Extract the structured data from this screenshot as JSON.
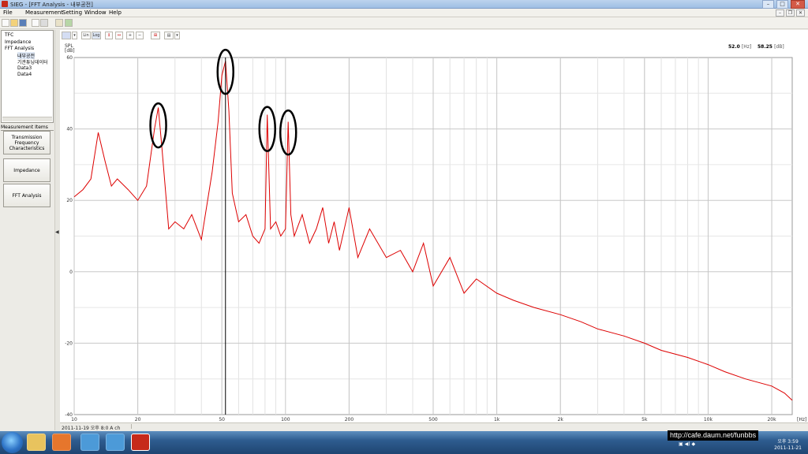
{
  "window": {
    "title": "SIEG - [FFT Analysis - 내부공전]"
  },
  "menu": [
    {
      "label": "File"
    },
    {
      "label": "Measurement"
    },
    {
      "label": "Setting"
    },
    {
      "label": "Window"
    },
    {
      "label": "Help"
    }
  ],
  "tree": [
    {
      "label": "TFC"
    },
    {
      "label": "Impedance"
    },
    {
      "label": "FFT Analysis"
    },
    {
      "label": "내부공전"
    },
    {
      "label": "기관튜닝데이터"
    },
    {
      "label": "Data3"
    },
    {
      "label": "Data4"
    }
  ],
  "measurement_items": {
    "header": "Measurement Items",
    "buttons": [
      {
        "label": "Transmission\nFrequency\nCharacteristics"
      },
      {
        "label": "Impedance"
      },
      {
        "label": "FFT Analysis"
      }
    ]
  },
  "chart_toolbar": {
    "lin_label": "Lin",
    "log_label": "Log"
  },
  "readout": {
    "freq": "52.0",
    "freq_unit": "[Hz]",
    "level": "58.25",
    "level_unit": "[dB]"
  },
  "status": {
    "text": "2011-11-19 오후 8:0 A ch"
  },
  "watermark": "http://cafe.daum.net/funbbs",
  "clock": {
    "time": "오후 3:59",
    "date": "2011-11-21"
  },
  "chart_data": {
    "type": "line",
    "ylabel": "SPL\n[dB]",
    "xlabel_unit": "[Hz]",
    "x_scale": "log",
    "xlim": [
      10,
      25000
    ],
    "ylim": [
      -40,
      60
    ],
    "grid": true,
    "line_color": "#dd0000",
    "y_ticks": [
      "60",
      "40",
      "20",
      "0",
      "-20",
      "-40"
    ],
    "y_tick_values": [
      60,
      40,
      20,
      0,
      -20,
      -40
    ],
    "x_ticks": [
      "10",
      "20",
      "50",
      "100",
      "200",
      "500",
      "1k",
      "2k",
      "5k",
      "10k",
      "20k"
    ],
    "x_tick_values": [
      10,
      20,
      50,
      100,
      200,
      500,
      1000,
      2000,
      5000,
      10000,
      20000
    ],
    "cursor_x": 52,
    "series": [
      {
        "x": [
          10,
          11,
          12,
          13,
          14,
          15,
          16,
          18,
          20,
          22,
          24,
          25,
          26,
          28,
          30,
          33,
          36,
          40,
          45,
          48,
          50,
          52,
          54,
          56,
          60,
          65,
          70,
          75,
          80,
          82,
          85,
          90,
          95,
          100,
          103,
          106,
          110,
          120,
          130,
          140,
          150,
          160,
          170,
          180,
          200,
          220,
          250,
          300,
          350,
          400,
          450,
          500,
          600,
          700,
          800,
          1000,
          1200,
          1500,
          2000,
          2500,
          3000,
          4000,
          5000,
          6000,
          8000,
          10000,
          12000,
          15000,
          20000,
          23000,
          25000
        ],
        "y": [
          21,
          23,
          26,
          39,
          31,
          24,
          26,
          23,
          20,
          24,
          40,
          46,
          35,
          12,
          14,
          12,
          16,
          9,
          28,
          42,
          55,
          59,
          45,
          22,
          14,
          16,
          10,
          8,
          12,
          44,
          12,
          14,
          10,
          12,
          42,
          16,
          10,
          16,
          8,
          12,
          18,
          8,
          14,
          6,
          18,
          4,
          12,
          4,
          6,
          0,
          8,
          -4,
          4,
          -6,
          -2,
          -6,
          -8,
          -10,
          -12,
          -14,
          -16,
          -18,
          -20,
          -22,
          -24,
          -26,
          -28,
          -30,
          -32,
          -34,
          -36
        ]
      }
    ],
    "annotations": [
      {
        "x": 25,
        "y": 41,
        "shape": "ellipse"
      },
      {
        "x": 52,
        "y": 56,
        "shape": "ellipse"
      },
      {
        "x": 82,
        "y": 40,
        "shape": "ellipse"
      },
      {
        "x": 103,
        "y": 39,
        "shape": "ellipse"
      }
    ]
  }
}
